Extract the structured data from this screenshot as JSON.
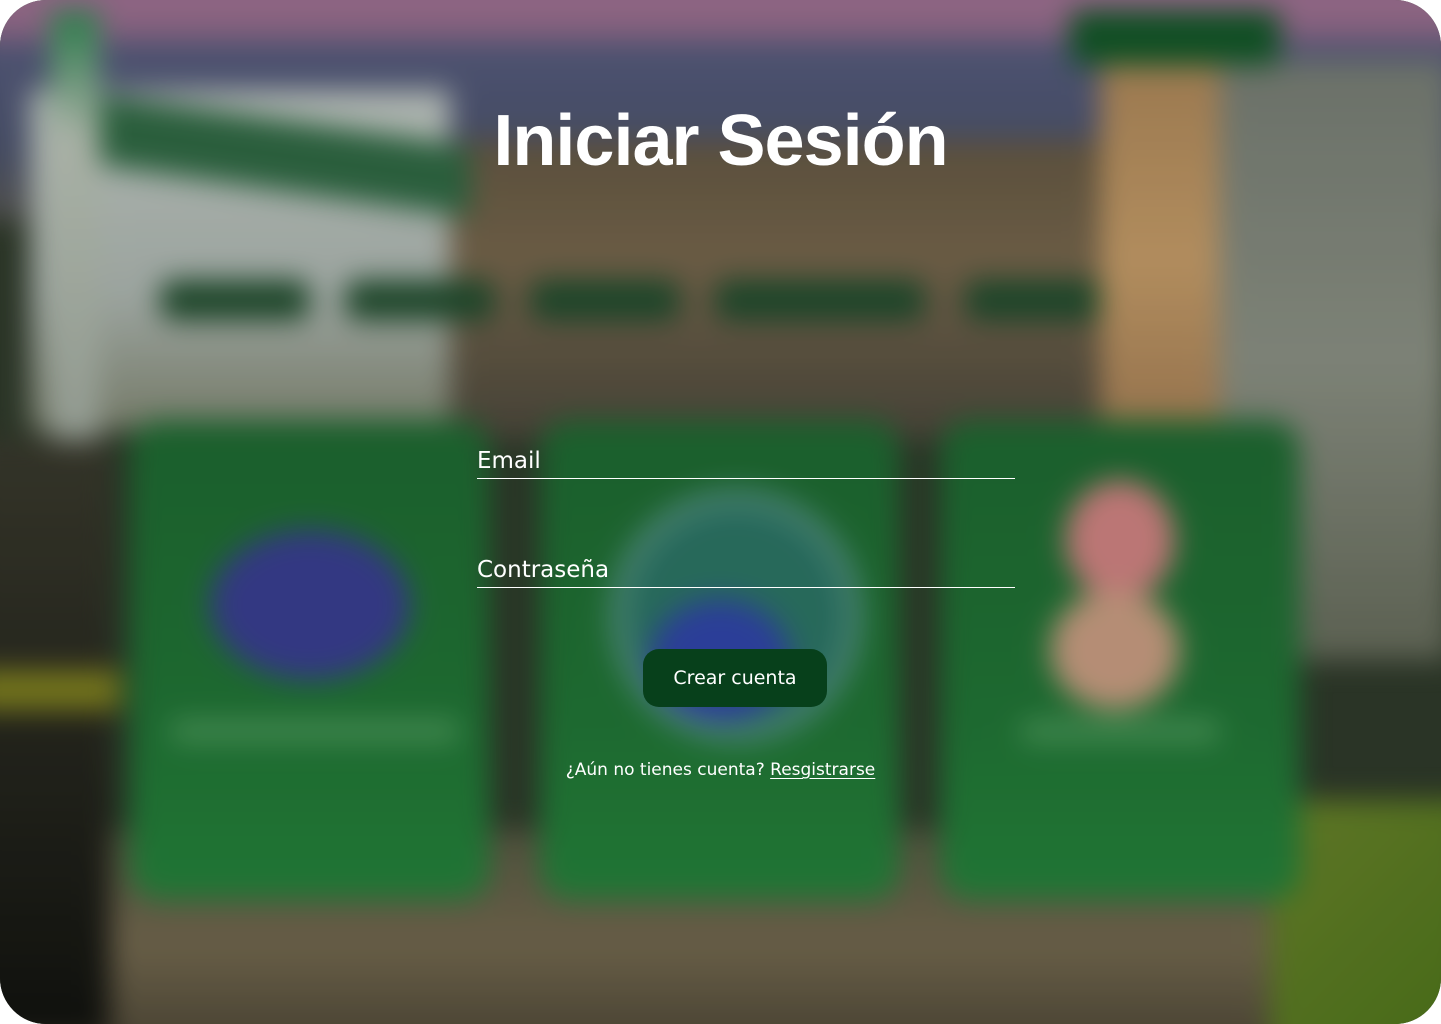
{
  "page": {
    "title": "Iniciar Sesión"
  },
  "form": {
    "email": {
      "placeholder": "Email",
      "value": ""
    },
    "password": {
      "placeholder": "Contraseña",
      "value": ""
    },
    "submit_label": "Crear cuenta"
  },
  "signup": {
    "prompt": "¿Aún no tienes cuenta?",
    "link_label": "Resgistrarse"
  },
  "colors": {
    "button_bg": "#07401b",
    "text": "#ffffff",
    "sky": "#b27aa2",
    "card_green": "#1f7a36"
  }
}
